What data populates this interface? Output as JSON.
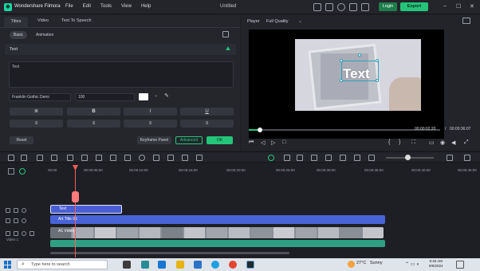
{
  "app": {
    "name": "Wondershare Filmora",
    "doc_title": "Untitled",
    "login": "Login",
    "export": "Export"
  },
  "menu": [
    "File",
    "Edit",
    "Tools",
    "View",
    "Help"
  ],
  "panel": {
    "tabs": [
      "Titles",
      "Video",
      "Text To Speech"
    ],
    "subtabs": [
      "Basic",
      "Animation"
    ],
    "section": "Text",
    "text_value": "Text",
    "font": "Franklin Gothic Demi",
    "size": "100",
    "format": [
      "B",
      "I",
      "U"
    ],
    "reset": "Reset",
    "keyframe": "Keyframe Panel",
    "advanced": "Advanced",
    "ok": "OK"
  },
  "player": {
    "label": "Player",
    "quality": "Full Quality",
    "overlay_text": "Text",
    "time_current": "00:00:02:20",
    "time_sep": "/",
    "time_total": "00:00:36:07",
    "progress": 0.06
  },
  "ruler": [
    "00:00",
    "00:00:05:00",
    "00:00:10:00",
    "00:00:15:00",
    "00:00:20:00",
    "00:00:25:00",
    "00:00:30:00",
    "00:00:35:00",
    "00:00:40:00",
    "00:00:45:00"
  ],
  "tracks": {
    "text_clip": "Text",
    "art_clip": "Art Title 06",
    "video_clip": "A1 Video",
    "video_label": "Video 1"
  },
  "taskbar": {
    "search_placeholder": "Type here to search",
    "temp": "27°C",
    "weather": "Sunny",
    "time": "9:40 AM",
    "date": "9/6/2024"
  },
  "colors": {
    "accent": "#25c47a",
    "clip": "#4a5fd3",
    "playhead": "#ff5a5a",
    "audio": "#2f9f84"
  }
}
